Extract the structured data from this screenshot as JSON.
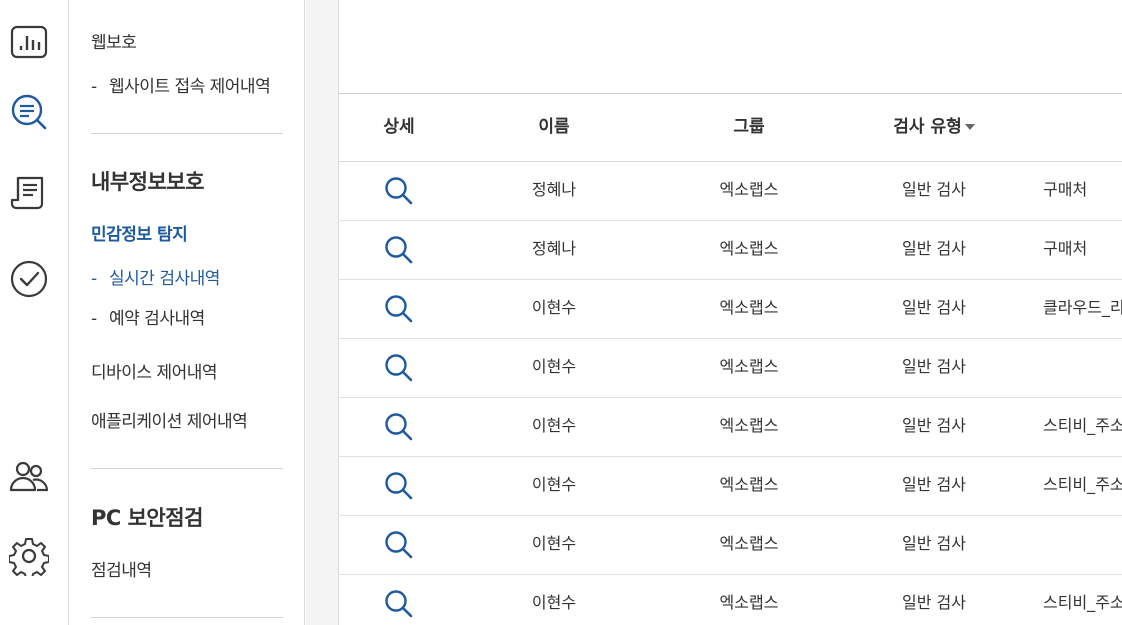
{
  "rail": {
    "icons": [
      "dashboard-chart-icon",
      "search-document-icon",
      "report-scroll-icon",
      "check-circle-icon",
      "users-icon",
      "gear-icon"
    ]
  },
  "nav": {
    "web_protection": "웹보호",
    "website_access_control": "웹사이트 접속 제어내역",
    "internal_info_protection": "내부정보보호",
    "sensitive_info_detection": "민감정보 탐지",
    "realtime_scan_history": "실시간 검사내역",
    "scheduled_scan_history": "예약 검사내역",
    "device_control_history": "디바이스 제어내역",
    "application_control_history": "애플리케이션 제어내역",
    "pc_security_check": "PC 보안점검",
    "check_history": "점검내역",
    "dash": "-"
  },
  "table": {
    "headers": {
      "detail": "상세",
      "name": "이름",
      "group": "그룹",
      "scan_type": "검사 유형"
    },
    "rows": [
      {
        "name": "정혜나",
        "group": "엑소랩스",
        "scan_type": "일반 검사",
        "extra": "구매처"
      },
      {
        "name": "정혜나",
        "group": "엑소랩스",
        "scan_type": "일반 검사",
        "extra": "구매처"
      },
      {
        "name": "이현수",
        "group": "엑소랩스",
        "scan_type": "일반 검사",
        "extra": "클라우드_리"
      },
      {
        "name": "이현수",
        "group": "엑소랩스",
        "scan_type": "일반 검사",
        "extra": ""
      },
      {
        "name": "이현수",
        "group": "엑소랩스",
        "scan_type": "일반 검사",
        "extra": "스티비_주소"
      },
      {
        "name": "이현수",
        "group": "엑소랩스",
        "scan_type": "일반 검사",
        "extra": "스티비_주소"
      },
      {
        "name": "이현수",
        "group": "엑소랩스",
        "scan_type": "일반 검사",
        "extra": ""
      },
      {
        "name": "이현수",
        "group": "엑소랩스",
        "scan_type": "일반 검사",
        "extra": "스티비_주소"
      }
    ]
  },
  "colors": {
    "accent": "#1f5aa0",
    "icon": "#3a3a3a",
    "search_icon": "#1f5aa0"
  }
}
